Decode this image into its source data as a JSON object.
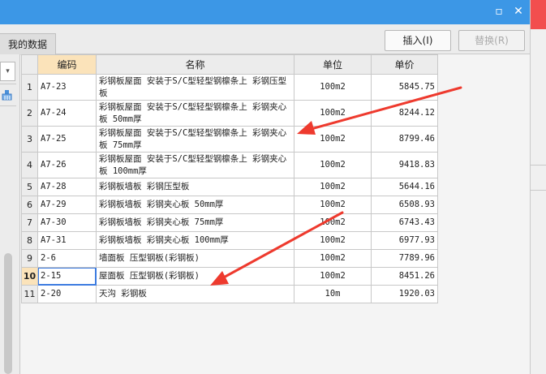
{
  "titlebar": {
    "restore_glyph": "▫",
    "close_glyph": "✕"
  },
  "tabs": {
    "my_data": "我的数据"
  },
  "toolbar": {
    "insert": "插入(I)",
    "replace": "替换(R)"
  },
  "left_panel": {
    "dropdown_glyph": "▾"
  },
  "grid": {
    "headers": {
      "row_no": "",
      "code": "编码",
      "name": "名称",
      "unit": "单位",
      "price": "单价"
    },
    "rows": [
      {
        "no": "1",
        "code": "A7-23",
        "name": "彩钢板屋面 安装于S/C型轻型钢檩条上 彩钢压型板",
        "unit": "100m2",
        "price": "5845.75"
      },
      {
        "no": "2",
        "code": "A7-24",
        "name": "彩钢板屋面 安装于S/C型轻型钢檩条上 彩钢夹心板 50mm厚",
        "unit": "100m2",
        "price": "8244.12"
      },
      {
        "no": "3",
        "code": "A7-25",
        "name": "彩钢板屋面 安装于S/C型轻型钢檩条上 彩钢夹心板 75mm厚",
        "unit": "100m2",
        "price": "8799.46"
      },
      {
        "no": "4",
        "code": "A7-26",
        "name": "彩钢板屋面 安装于S/C型轻型钢檩条上 彩钢夹心板 100mm厚",
        "unit": "100m2",
        "price": "9418.83"
      },
      {
        "no": "5",
        "code": "A7-28",
        "name": "彩钢板墙板 彩钢压型板",
        "unit": "100m2",
        "price": "5644.16"
      },
      {
        "no": "6",
        "code": "A7-29",
        "name": "彩钢板墙板 彩钢夹心板 50mm厚",
        "unit": "100m2",
        "price": "6508.93"
      },
      {
        "no": "7",
        "code": "A7-30",
        "name": "彩钢板墙板 彩钢夹心板 75mm厚",
        "unit": "100m2",
        "price": "6743.43"
      },
      {
        "no": "8",
        "code": "A7-31",
        "name": "彩钢板墙板 彩钢夹心板 100mm厚",
        "unit": "100m2",
        "price": "6977.93"
      },
      {
        "no": "9",
        "code": "2-6",
        "name": "墙面板 压型钢板(彩钢板)",
        "unit": "100m2",
        "price": "7789.96"
      },
      {
        "no": "10",
        "code": "2-15",
        "name": "屋面板 压型钢板(彩钢板)",
        "unit": "100m2",
        "price": "8451.26"
      },
      {
        "no": "11",
        "code": "2-20",
        "name": "天沟 彩钢板",
        "unit": "10m",
        "price": "1920.03"
      }
    ]
  },
  "colors": {
    "title_bar": "#3c97e6",
    "selected_header": "#fbe3ba",
    "annotation_arrow": "#ee3a2e"
  }
}
